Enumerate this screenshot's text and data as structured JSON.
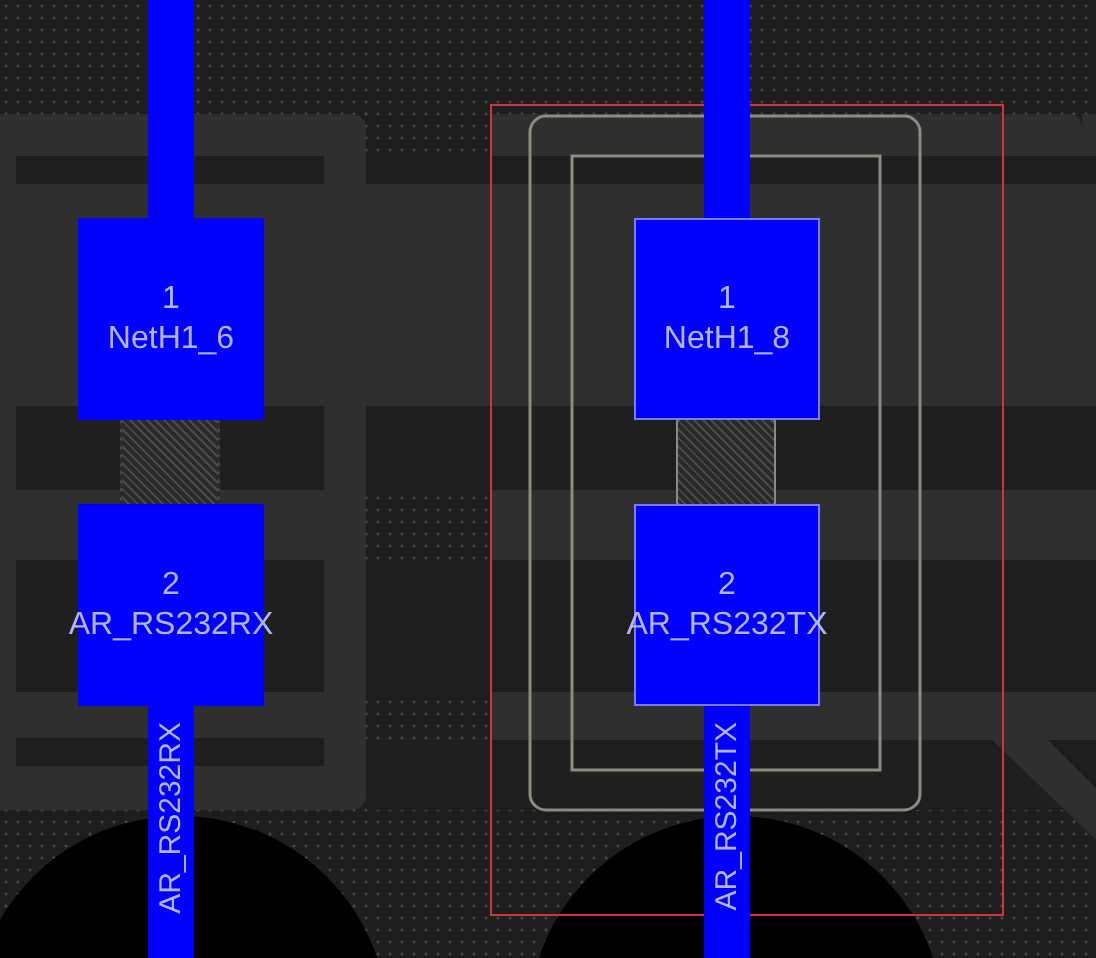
{
  "components": [
    {
      "selected": false,
      "pads": [
        {
          "number": "1",
          "net": "NetH1_6"
        },
        {
          "number": "2",
          "net": "AR_RS232RX"
        }
      ],
      "trace_label": "AR_RS232RX"
    },
    {
      "selected": true,
      "pads": [
        {
          "number": "1",
          "net": "NetH1_8"
        },
        {
          "number": "2",
          "net": "AR_RS232TX"
        }
      ],
      "trace_label": "AR_RS232TX"
    }
  ]
}
